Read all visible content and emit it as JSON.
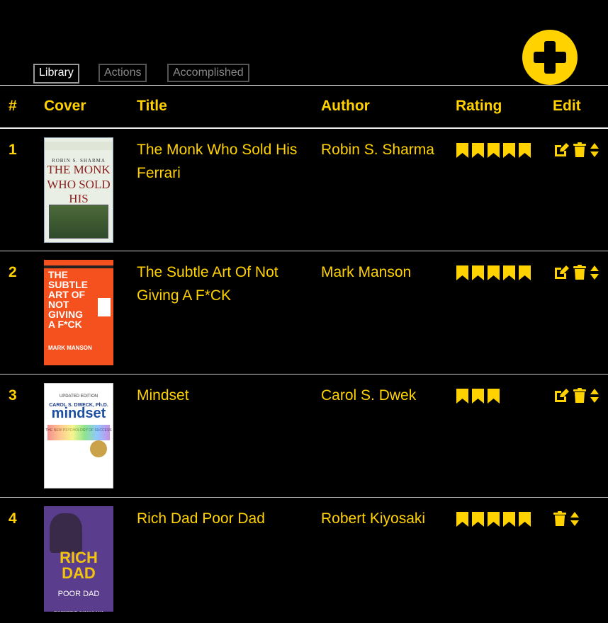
{
  "tabs": [
    {
      "label": "Library",
      "active": true
    },
    {
      "label": "Actions",
      "active": false
    },
    {
      "label": "Accomplished",
      "active": false
    }
  ],
  "add_button": {
    "icon": "plus-icon"
  },
  "table": {
    "headers": {
      "num": "#",
      "cover": "Cover",
      "title": "Title",
      "author": "Author",
      "rating": "Rating",
      "edit": "Edit"
    },
    "rows": [
      {
        "num": "1",
        "title": "The Monk Who Sold His Ferrari",
        "author": "Robin S. Sharma",
        "rating": 5,
        "has_edit": true,
        "cover": {
          "author": "ROBIN S. SHARMA",
          "line1": "THE MONK",
          "line2": "WHO SOLD",
          "line3": "HIS FERRARI"
        }
      },
      {
        "num": "2",
        "title": "The Subtle Art Of Not Giving A F*CK",
        "author": "Mark Manson",
        "rating": 5,
        "has_edit": true,
        "cover": {
          "line1": "THE",
          "line2": "SUBTLE",
          "line3": "ART OF",
          "line4": "NOT",
          "line5": "GIVING",
          "line6": "A F*CK",
          "author": "MARK MANSON"
        }
      },
      {
        "num": "3",
        "title": "Mindset",
        "author": "Carol S. Dwek",
        "rating": 3,
        "has_edit": true,
        "cover": {
          "edition": "UPDATED EDITION",
          "author": "CAROL S. DWECK, Ph.D.",
          "title": "mindset",
          "subtitle": "THE NEW PSYCHOLOGY OF SUCCESS"
        }
      },
      {
        "num": "4",
        "title": "Rich Dad Poor Dad",
        "author": "Robert Kiyosaki",
        "rating": 5,
        "has_edit": false,
        "cover": {
          "line1": "RICH",
          "line2": "DAD",
          "line3": "POOR DAD",
          "author": "ROBERT T. KIYOSAKI"
        }
      }
    ]
  },
  "colors": {
    "accent": "#ffd200",
    "background": "#000000"
  },
  "icons": {
    "rating": "bookmark-icon",
    "edit": "edit-icon",
    "delete": "trash-icon",
    "reorder": "sort-icon"
  }
}
